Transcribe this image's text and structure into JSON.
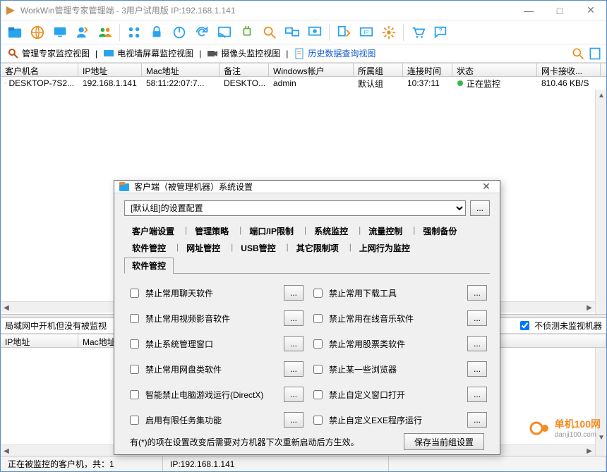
{
  "window": {
    "title": "WorkWin管理专家管理端 - 3用户试用版 IP:192.168.1.141"
  },
  "toolbar2": {
    "items": [
      {
        "label": "管理专家监控视图",
        "blue": false
      },
      {
        "label": "电视墙屏幕监控视图",
        "blue": false
      },
      {
        "label": "摄像头监控视图",
        "blue": false
      },
      {
        "label": "历史数据查询视图",
        "blue": true
      }
    ]
  },
  "grid": {
    "cols": [
      "客户机名",
      "IP地址",
      "Mac地址",
      "备注",
      "Windows帐户",
      "所属组",
      "连接时间",
      "状态",
      "网卡接收..."
    ],
    "row": {
      "name": "DESKTOP-7S2...",
      "ip": "192.168.1.141",
      "mac": "58:11:22:07:7...",
      "note": "DESKTO...",
      "user": "admin",
      "group": "默认组",
      "time": "10:37:11",
      "status": "正在监控",
      "net": "810.46 KB/S"
    }
  },
  "lower": {
    "header": "局域网中开机但没有被监视",
    "checkbox": "不侦测未监视机器",
    "cols": [
      "IP地址",
      "Mac地址"
    ]
  },
  "status": {
    "left": "正在被监控的客户机，共：1",
    "right": "IP:192.168.1.141"
  },
  "watermark": {
    "brand": "单机100网",
    "url": "danji100.com"
  },
  "dialog": {
    "title": "客户端（被管理机器）系统设置",
    "config_label": "[默认组]的设置配置",
    "more": "...",
    "tabs_row1": [
      "客户端设置",
      "管理策略",
      "端口/IP限制",
      "系统监控",
      "流量控制",
      "强制备份"
    ],
    "tabs_row2": [
      "软件管控",
      "网址管控",
      "USB管控",
      "其它限制项",
      "上网行为监控"
    ],
    "tabs_row3": [
      "软件管控"
    ],
    "options_left": [
      "禁止常用聊天软件",
      "禁止常用视频影音软件",
      "禁止系统管理窗口",
      "禁止常用网盘类软件",
      "智能禁止电脑游戏运行(DirectX)",
      "启用有限任务集功能"
    ],
    "options_right": [
      "禁止常用下载工具",
      "禁止常用在线音乐软件",
      "禁止常用股票类软件",
      "禁止某一些浏览器",
      "禁止自定义窗口打开",
      "禁止自定义EXE程序运行"
    ],
    "footnote": "有(*)的项在设置改变后需要对方机器下次重新启动后方生效。",
    "save": "保存当前组设置"
  }
}
